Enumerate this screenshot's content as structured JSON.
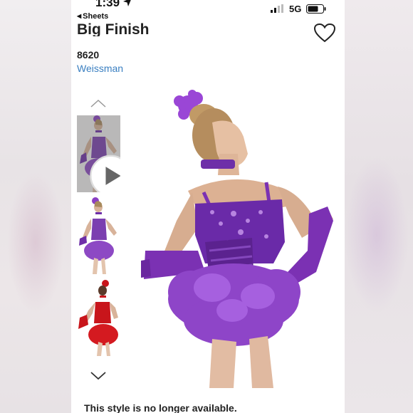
{
  "status_bar": {
    "time": "1:39",
    "back_label": "Sheets",
    "network": "5G",
    "icons": [
      "location-arrow-icon",
      "signal-icon",
      "battery-icon"
    ]
  },
  "product": {
    "title": "Big Finish",
    "style_number": "8620",
    "brand": "Weissman",
    "availability": "This style is no longer available."
  },
  "gallery": {
    "thumbnails": [
      {
        "name": "thumbnail-purple-video",
        "has_play_icon": true
      },
      {
        "name": "thumbnail-purple"
      },
      {
        "name": "thumbnail-red"
      }
    ],
    "main_image": "purple-costume"
  },
  "colors": {
    "link": "#3a7fc1",
    "purple": "#7b3fb0",
    "red": "#c8151b"
  }
}
